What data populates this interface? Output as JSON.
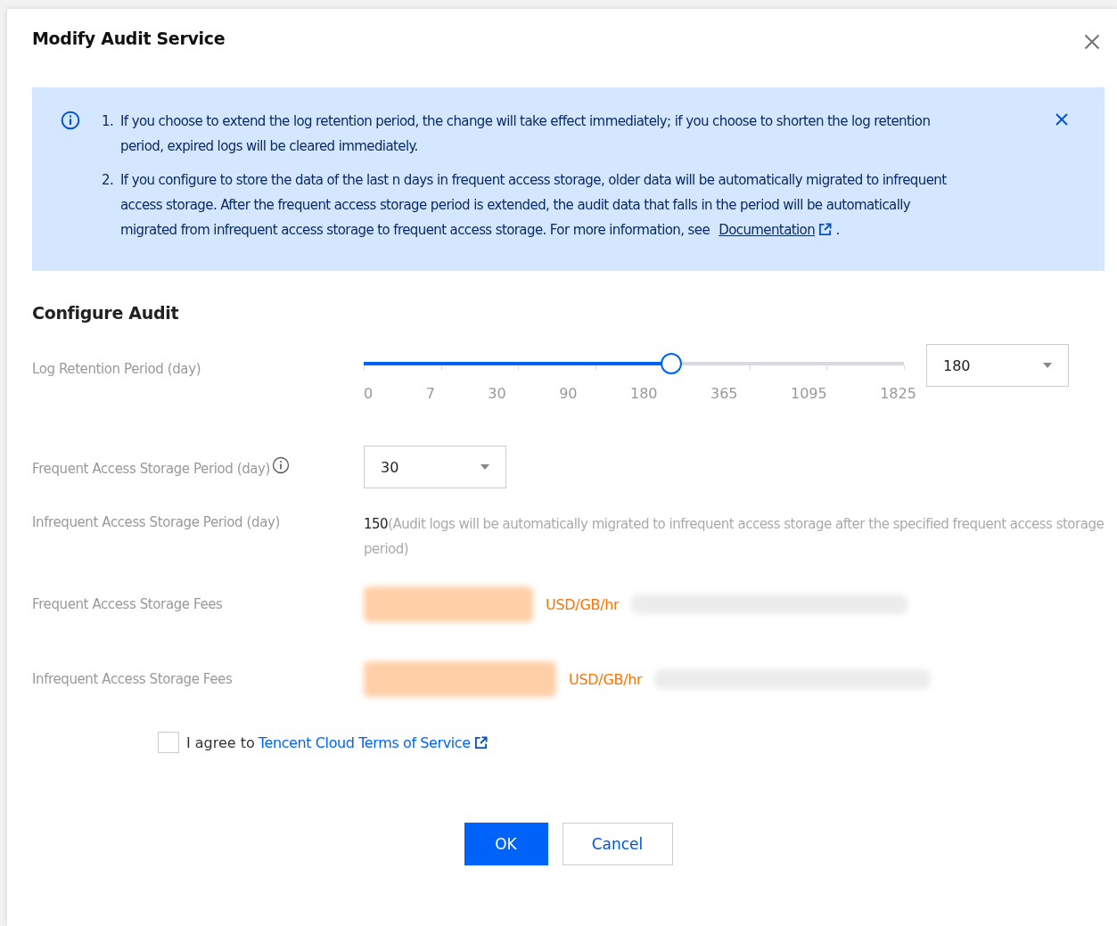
{
  "dialog": {
    "title": "Modify Audit Service"
  },
  "notice": {
    "items": [
      {
        "number": "1.",
        "text": "If you choose to extend the log retention period, the change will take effect immediately; if you choose to shorten the log retention period, expired logs will be cleared immediately."
      },
      {
        "number": "2.",
        "text": "If you configure to store the data of the last n days in frequent access storage, older data will be automatically migrated to infrequent access storage. After the frequent access storage period is extended, the audit data that falls in the period will be automatically migrated from infrequent access storage to frequent access storage. For more information, see",
        "link": "Documentation",
        "after": "."
      }
    ]
  },
  "section": {
    "title": "Configure Audit"
  },
  "fields": [
    {
      "kind": "slider",
      "label": "Log Retention Period (day)",
      "level": 0.571,
      "ticks": [
        "0",
        "7",
        "30",
        "90",
        "180",
        "365",
        "1095",
        "1825"
      ],
      "value": "180"
    },
    {
      "kind": "select",
      "label": "Frequent Access Storage Period (day)",
      "info": true,
      "value": "30"
    },
    {
      "kind": "text",
      "label": "Infrequent Access Storage Period (day)",
      "value": "150",
      "note": "(Audit logs will be automatically migrated to infrequent access storage after the specified frequent access storage period)"
    },
    {
      "kind": "fee",
      "label": "Frequent Access Storage Fees",
      "unit": "USD/GB/hr"
    },
    {
      "kind": "fee",
      "label": "Infrequent Access Storage Fees",
      "unit": "USD/GB/hr"
    }
  ],
  "agreement": {
    "checked": false,
    "text": "I agree to",
    "link": "Tencent Cloud Terms of Service"
  },
  "buttons": [
    {
      "label": "OK",
      "primary": true
    },
    {
      "label": "Cancel",
      "primary": false
    }
  ]
}
